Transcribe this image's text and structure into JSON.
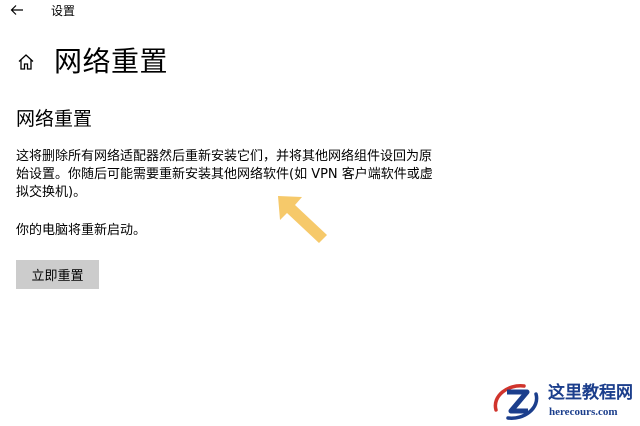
{
  "window": {
    "title": "设置",
    "back_icon": "arrow-left-icon"
  },
  "header": {
    "home_icon": "home-icon",
    "title": "网络重置"
  },
  "section": {
    "title": "网络重置",
    "description": "这将删除所有网络适配器然后重新安装它们，并将其他网络组件设回为原始设置。你随后可能需要重新安装其他网络软件(如 VPN 客户端软件或虚拟交换机)。",
    "restart_note": "你的电脑将重新启动。",
    "reset_button_label": "立即重置"
  },
  "annotation": {
    "arrow_icon": "pointer-arrow-icon",
    "arrow_color": "#f6c96a"
  },
  "watermark": {
    "name": "这里教程网",
    "url": "herecours.com",
    "brand_color": "#1b3e8c",
    "accent_color": "#d0342c"
  },
  "colors": {
    "background": "#ffffff",
    "button_background": "#cccccc",
    "text": "#000000"
  }
}
